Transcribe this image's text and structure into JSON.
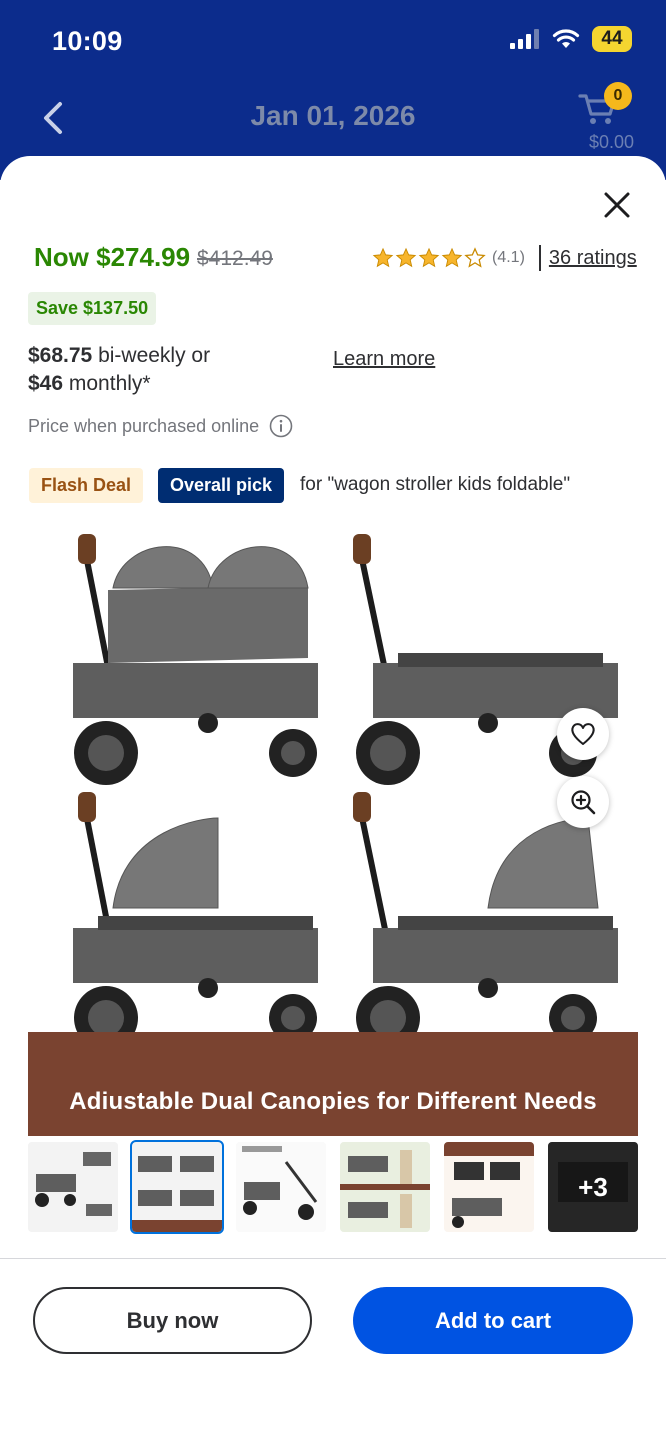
{
  "status_bar": {
    "time": "10:09",
    "battery": "44"
  },
  "header": {
    "date": "Jan 01, 2026",
    "cart_count": "0",
    "cart_total": "$0.00"
  },
  "product": {
    "price_now": "Now $274.99",
    "price_was": "$412.49",
    "rating_value": "(4.1)",
    "rating_stars": 4.1,
    "ratings_link": "36 ratings",
    "save_badge": "Save $137.50",
    "biweekly_amount": "$68.75",
    "biweekly_suffix": " bi-weekly or",
    "monthly_amount": "$46",
    "monthly_suffix": " monthly*",
    "learn_more": "Learn more",
    "price_note": "Price when purchased online",
    "flash_deal": "Flash Deal",
    "overall_pick": "Overall pick",
    "pick_for": "for \"wagon stroller kids foldable\"",
    "image_caption": "Adiustable Dual Canopies for Different Needs",
    "thumbnails_more": "+3"
  },
  "actions": {
    "buy_now": "Buy now",
    "add_to_cart": "Add to cart"
  },
  "colors": {
    "header_bg": "#0c2c8c",
    "price_green": "#2a8703",
    "primary_blue": "#0053e2",
    "badge_navy": "#002d72"
  }
}
